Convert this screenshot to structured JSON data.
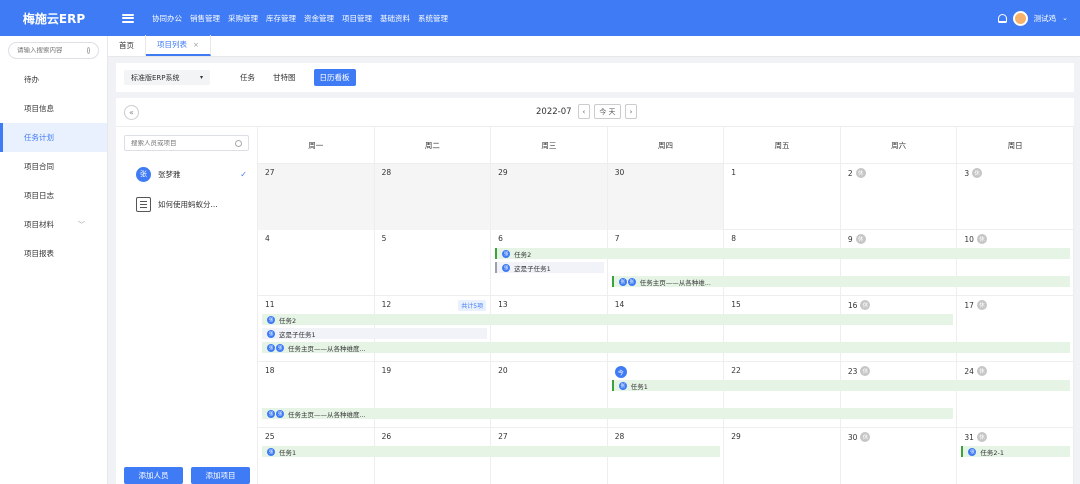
{
  "app": {
    "logo": "梅施云ERP"
  },
  "topnav": [
    "协同办公",
    "销售管理",
    "采购管理",
    "库存管理",
    "资金管理",
    "项目管理",
    "基础资料",
    "系统管理"
  ],
  "user": {
    "name": "测试鸡"
  },
  "sidebar": {
    "search_placeholder": "请输入搜索内容",
    "items": [
      {
        "label": "待办"
      },
      {
        "label": "项目信息"
      },
      {
        "label": "任务计划",
        "active": true
      },
      {
        "label": "项目合同"
      },
      {
        "label": "项目日志"
      },
      {
        "label": "项目材料",
        "expandable": true
      },
      {
        "label": "项目报表"
      }
    ]
  },
  "page_tabs": [
    {
      "label": "首页"
    },
    {
      "label": "项目列表",
      "closable": "×",
      "active": true
    }
  ],
  "toolbar": {
    "template_select": "标准版ERP系统",
    "view_tabs": [
      {
        "label": "任务"
      },
      {
        "label": "甘特图"
      },
      {
        "label": "日历看板",
        "active": true
      }
    ]
  },
  "calendar": {
    "month": "2022-07",
    "today_label": "今 天",
    "prev": "‹",
    "next": "›",
    "collapse": "«",
    "weekdays": [
      "周一",
      "周二",
      "周三",
      "周四",
      "周五",
      "周六",
      "周日"
    ],
    "rest_badge": "休",
    "today_badge": "今",
    "more_label": "共计5项",
    "weeks": [
      {
        "days": [
          "27",
          "28",
          "29",
          "30",
          "1",
          "2",
          "3"
        ]
      },
      {
        "days": [
          "4",
          "5",
          "6",
          "7",
          "8",
          "9",
          "10"
        ]
      },
      {
        "days": [
          "11",
          "12",
          "13",
          "14",
          "15",
          "16",
          "17"
        ]
      },
      {
        "days": [
          "18",
          "19",
          "20",
          "21",
          "22",
          "23",
          "24"
        ]
      },
      {
        "days": [
          "25",
          "26",
          "27",
          "28",
          "29",
          "30",
          "31"
        ]
      }
    ],
    "tasks": {
      "task2": "任务2",
      "subtask1": "这是子任务1",
      "main": "任务主页——从各种维...",
      "main2": "任务主页——从各种维度...",
      "task1": "任务1",
      "task2_1": "任务2-1"
    },
    "avatar_char": "张"
  },
  "left_panel": {
    "search_placeholder": "搜索人员或项目",
    "person": {
      "avatar": "张",
      "name": "张梦雅"
    },
    "project": {
      "name": "如何使用蚂蚁分..."
    },
    "add_person": "添加人员",
    "add_project": "添加项目"
  },
  "colors": {
    "primary": "#3f7bf5",
    "task_bar": "#e6f4e6",
    "task_edge": "#3aa33a"
  }
}
